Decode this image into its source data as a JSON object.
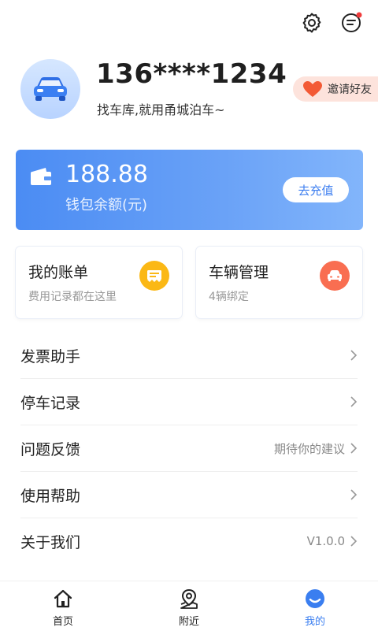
{
  "header": {
    "settings_icon": "gear-icon",
    "messages_icon": "message-icon",
    "has_unread": true
  },
  "profile": {
    "phone": "136****1234",
    "slogan": "找车库,就用甬城泊车~",
    "invite_label": "邀请好友"
  },
  "wallet": {
    "amount": "188.88",
    "label": "钱包余额(元)",
    "recharge_label": "去充值"
  },
  "cards": [
    {
      "title": "我的账单",
      "subtitle": "费用记录都在这里",
      "icon": "bill-icon",
      "color": "#fbb815"
    },
    {
      "title": "车辆管理",
      "subtitle": "4辆绑定",
      "icon": "car-icon",
      "color": "#f96e51"
    }
  ],
  "menu": [
    {
      "label": "发票助手",
      "hint": ""
    },
    {
      "label": "停车记录",
      "hint": ""
    },
    {
      "label": "问题反馈",
      "hint": "期待你的建议"
    },
    {
      "label": "使用帮助",
      "hint": ""
    },
    {
      "label": "关于我们",
      "hint": "V1.0.0"
    }
  ],
  "nav": [
    {
      "label": "首页",
      "icon": "home-icon"
    },
    {
      "label": "附近",
      "icon": "map-pin-icon"
    },
    {
      "label": "我的",
      "icon": "profile-icon",
      "active": true
    }
  ],
  "colors": {
    "accent": "#3a7ef0",
    "wallet_start": "#4b8cf3",
    "wallet_end": "#82b5fb",
    "invite_bg": "#fde3dc"
  }
}
